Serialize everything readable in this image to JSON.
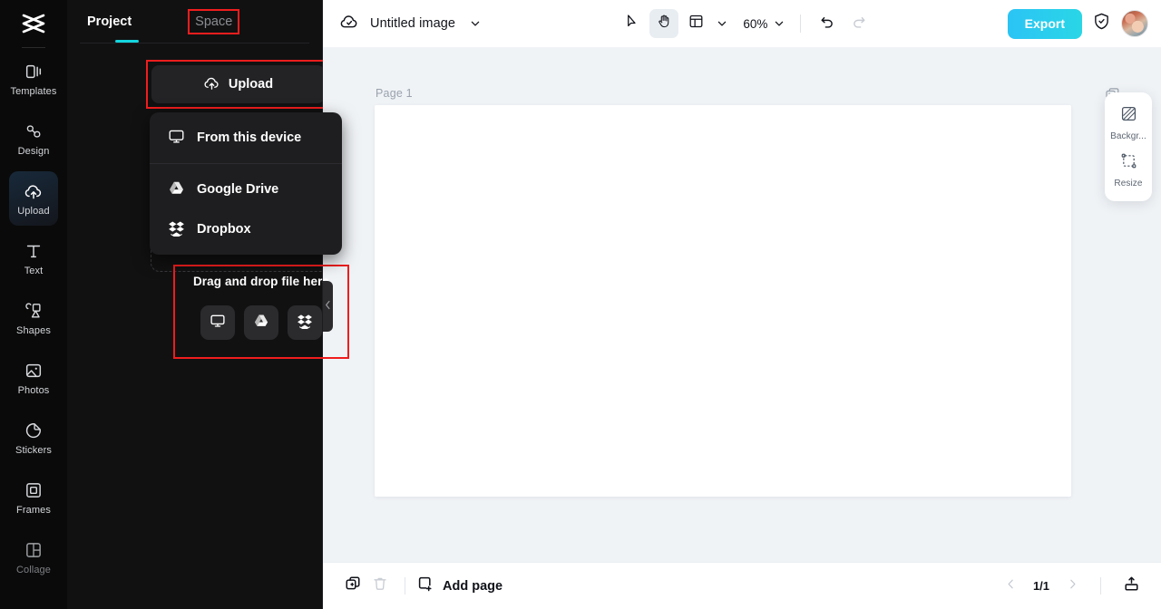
{
  "app": {
    "logo": "capcut-logo",
    "accent_cyan": "#14d6e0",
    "highlight_red": "#f01d1d",
    "panel_bg": "#111112",
    "canvas_bg": "#f0f3f6"
  },
  "rail": {
    "items": [
      {
        "label": "Templates",
        "icon": "templates-icon",
        "active": false
      },
      {
        "label": "Design",
        "icon": "design-icon",
        "active": false
      },
      {
        "label": "Upload",
        "icon": "upload-cloud-icon",
        "active": true
      },
      {
        "label": "Text",
        "icon": "text-icon",
        "active": false
      },
      {
        "label": "Shapes",
        "icon": "shapes-icon",
        "active": false
      },
      {
        "label": "Photos",
        "icon": "photos-icon",
        "active": false
      },
      {
        "label": "Stickers",
        "icon": "sticker-icon",
        "active": false
      },
      {
        "label": "Frames",
        "icon": "frames-icon",
        "active": false
      },
      {
        "label": "Collage",
        "icon": "collage-icon",
        "active": false
      }
    ]
  },
  "panel": {
    "tabs": [
      {
        "label": "Project",
        "active": true
      },
      {
        "label": "Space",
        "active": false
      }
    ],
    "upload_button": "Upload",
    "upload_icon": "upload-cloud-icon",
    "phone_button_icon": "mobile-phone-icon",
    "menu": [
      {
        "label": "From this device",
        "icon": "monitor-icon"
      },
      {
        "label": "Google Drive",
        "icon": "google-drive-icon"
      },
      {
        "label": "Dropbox",
        "icon": "dropbox-icon"
      }
    ],
    "dropzone": {
      "title": "Drag and drop file here",
      "sources": [
        {
          "icon": "monitor-icon"
        },
        {
          "icon": "google-drive-icon"
        },
        {
          "icon": "dropbox-icon"
        }
      ]
    },
    "collapse_icon": "chevron-left-icon"
  },
  "topbar": {
    "cloud_icon": "cloud-sync-icon",
    "doc_title": "Untitled image",
    "title_chevron": "chevron-down-icon",
    "tools": [
      {
        "icon": "cursor-select-icon",
        "selected": false
      },
      {
        "icon": "hand-pan-icon",
        "selected": true
      },
      {
        "icon": "layout-grid-icon",
        "selected": false
      }
    ],
    "layout_chevron": "chevron-down-icon",
    "zoom_level": "60%",
    "zoom_chevron": "chevron-down-icon",
    "undo_icon": "undo-icon",
    "redo_icon": "redo-icon",
    "export_label": "Export",
    "shield_icon": "shield-check-icon",
    "avatar": "user-avatar"
  },
  "canvas": {
    "page_label": "Page 1",
    "duplicate_icon": "duplicate-image-icon"
  },
  "float_panel": {
    "items": [
      {
        "label": "Backgr...",
        "icon": "background-pattern-icon"
      },
      {
        "label": "Resize",
        "icon": "resize-icon"
      }
    ]
  },
  "bottombar": {
    "duplicate_icon": "duplicate-page-icon",
    "delete_icon": "trash-icon",
    "add_page_label": "Add page",
    "add_page_icon": "add-page-icon",
    "prev_icon": "chevron-left-icon",
    "page_indicator": "1/1",
    "next_icon": "chevron-right-icon",
    "export_panel_icon": "export-tray-icon"
  }
}
